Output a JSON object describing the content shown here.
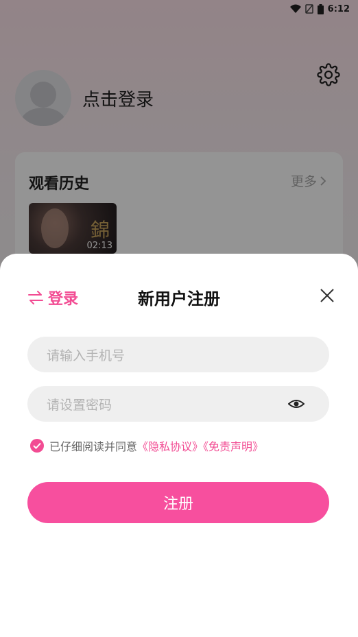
{
  "status_bar": {
    "time": "6:12",
    "icons": [
      "wifi-icon",
      "no-sim-icon",
      "battery-icon"
    ]
  },
  "profile": {
    "login_prompt": "点击登录"
  },
  "history": {
    "title": "观看历史",
    "more_label": "更多",
    "items": [
      {
        "duration": "02:13",
        "poster_glyph": "錦"
      }
    ]
  },
  "sheet": {
    "switch_label": "登录",
    "title": "新用户注册",
    "phone_placeholder": "请输入手机号",
    "password_placeholder": "请设置密码",
    "agreement_prefix": "已仔细阅读并同意",
    "privacy_link": "《隐私协议》",
    "disclaimer_link": "《免责声明》",
    "register_label": "注册"
  },
  "colors": {
    "accent": "#f24c93",
    "button": "#f74f9e"
  }
}
